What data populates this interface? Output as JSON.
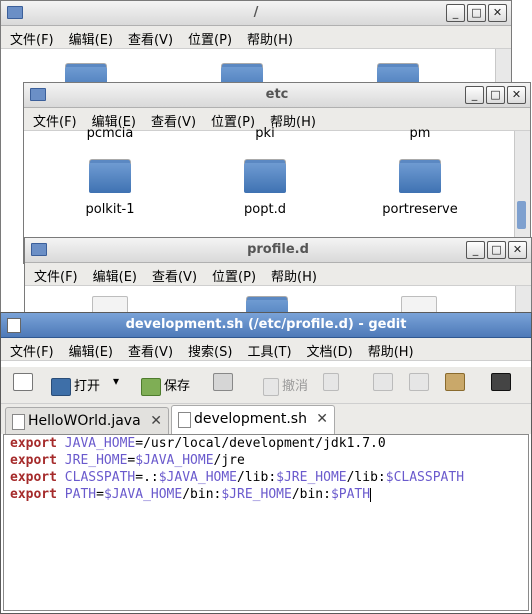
{
  "colors": {
    "keyword": "#a52a2a",
    "variable": "#6a5acd"
  },
  "menu_fm": [
    "文件(F)",
    "编辑(E)",
    "查看(V)",
    "位置(P)",
    "帮助(H)"
  ],
  "win_root": {
    "title": "/"
  },
  "win_etc": {
    "title": "etc",
    "cut_labels": [
      "pcmcia",
      "pki",
      "pm"
    ],
    "folders": [
      "polkit-1",
      "popt.d",
      "portreserve"
    ]
  },
  "win_profile": {
    "title": "profile.d"
  },
  "gedit": {
    "title": "development.sh (/etc/profile.d) - gedit",
    "menu": [
      "文件(F)",
      "编辑(E)",
      "查看(V)",
      "搜索(S)",
      "工具(T)",
      "文档(D)",
      "帮助(H)"
    ],
    "toolbar": {
      "open": "打开",
      "save": "保存",
      "undo": "撤消"
    },
    "tabs": [
      "HelloWOrld.java",
      "development.sh"
    ],
    "tab_close": "✕",
    "lines": [
      [
        {
          "t": "export",
          "c": "kw"
        },
        {
          "t": " "
        },
        {
          "t": "JAVA_HOME",
          "c": "var"
        },
        {
          "t": "=/usr/local/development/jdk1.7.0"
        }
      ],
      [
        {
          "t": "export",
          "c": "kw"
        },
        {
          "t": " "
        },
        {
          "t": "JRE_HOME",
          "c": "var"
        },
        {
          "t": "="
        },
        {
          "t": "$JAVA_HOME",
          "c": "var"
        },
        {
          "t": "/jre"
        }
      ],
      [
        {
          "t": "export",
          "c": "kw"
        },
        {
          "t": " "
        },
        {
          "t": "CLASSPATH",
          "c": "var"
        },
        {
          "t": "=.:"
        },
        {
          "t": "$JAVA_HOME",
          "c": "var"
        },
        {
          "t": "/lib:"
        },
        {
          "t": "$JRE_HOME",
          "c": "var"
        },
        {
          "t": "/lib:"
        },
        {
          "t": "$CLASSPATH",
          "c": "var"
        }
      ],
      [
        {
          "t": "export",
          "c": "kw"
        },
        {
          "t": " "
        },
        {
          "t": "PATH",
          "c": "var"
        },
        {
          "t": "="
        },
        {
          "t": "$JAVA_HOME",
          "c": "var"
        },
        {
          "t": "/bin:"
        },
        {
          "t": "$JRE_HOME",
          "c": "var"
        },
        {
          "t": "/bin:"
        },
        {
          "t": "$PATH",
          "c": "var"
        }
      ]
    ]
  }
}
